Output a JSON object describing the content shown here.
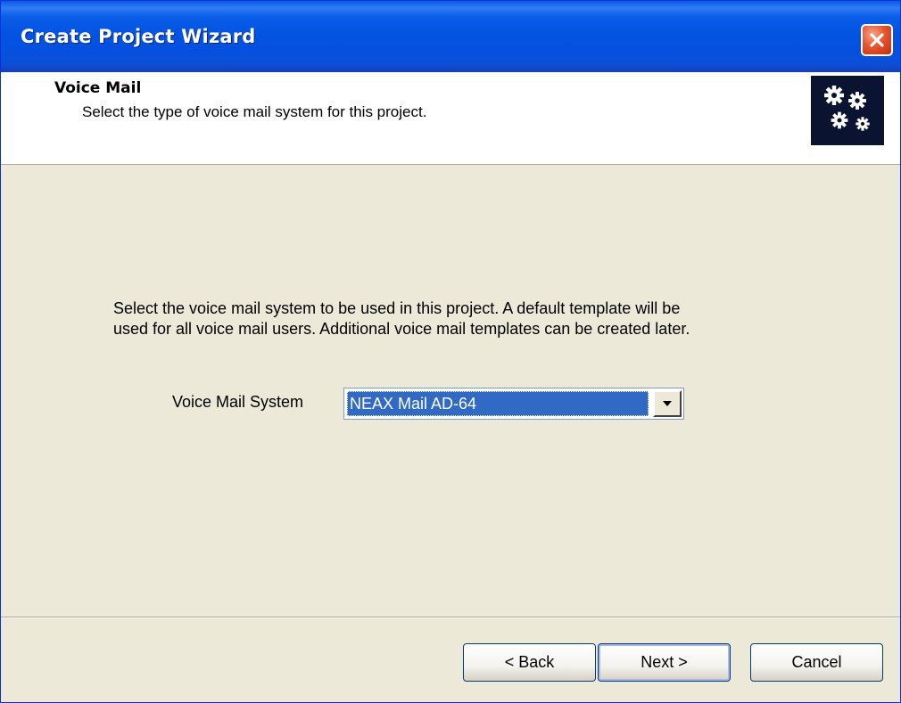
{
  "window": {
    "title": "Create Project Wizard"
  },
  "header": {
    "title": "Voice Mail",
    "subtitle": "Select the type of voice mail system for this project.",
    "icon": "gears-icon"
  },
  "main": {
    "description_line1": "Select the voice mail system to be used in this project. A default template will be",
    "description_line2": "used for all voice mail users. Additional voice mail templates can be created later.",
    "voice_mail_system": {
      "label": "Voice Mail System",
      "selected_value": "NEAX Mail AD-64"
    }
  },
  "buttons": {
    "back": "< Back",
    "next": "Next >",
    "cancel": "Cancel"
  },
  "colors": {
    "titlebar": "#0453e2",
    "dialog_background": "#ece9d8",
    "selection": "#316ac5",
    "close_button": "#e6552f"
  }
}
